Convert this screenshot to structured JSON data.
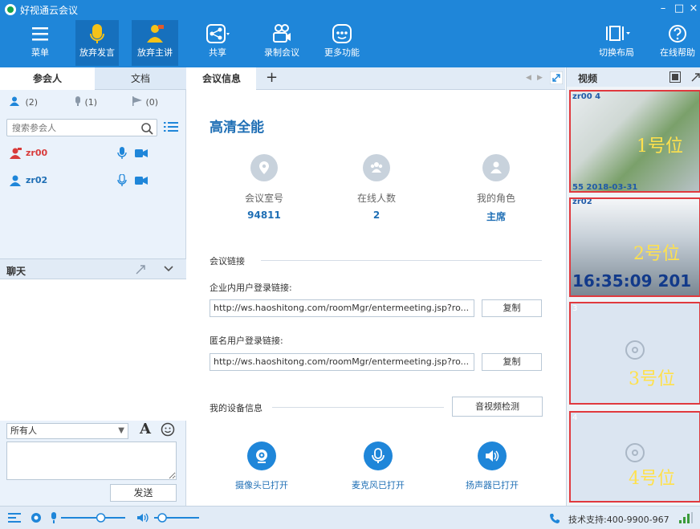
{
  "window": {
    "title": "好视通云会议"
  },
  "toolbar": {
    "menu": "菜单",
    "give_up_speaking": "放弃发言",
    "give_up_host": "放弃主讲",
    "share": "共享",
    "record": "录制会议",
    "more": "更多功能",
    "switch_layout": "切换布局",
    "help": "在线帮助"
  },
  "left": {
    "tabs": {
      "participants": "参会人",
      "documents": "文档"
    },
    "counts": {
      "people": "(2)",
      "mic": "(1)",
      "flag": "(0)"
    },
    "search": {
      "placeholder": "搜索参会人"
    },
    "participants": [
      {
        "name": "zr00",
        "role": "host"
      },
      {
        "name": "zr02",
        "role": "member"
      }
    ],
    "chat": {
      "title": "聊天",
      "recipient": "所有人",
      "font_button": "A",
      "send": "发送"
    }
  },
  "center": {
    "tabs": {
      "meeting_info": "会议信息",
      "add": "+"
    },
    "meeting_name": "高清全能",
    "stats": [
      {
        "label": "会议室号",
        "value": "94811"
      },
      {
        "label": "在线人数",
        "value": "2"
      },
      {
        "label": "我的角色",
        "value": "主席"
      }
    ],
    "links": {
      "section_title": "会议链接",
      "internal_label": "企业内用户登录链接:",
      "internal_url": "http://ws.haoshitong.com/roomMgr/entermeeting.jsp?ro...",
      "anonymous_label": "匿名用户登录链接:",
      "anonymous_url": "http://ws.haoshitong.com/roomMgr/entermeeting.jsp?ro...",
      "copy": "复制"
    },
    "devices": {
      "section_title": "我的设备信息",
      "check_button": "音视频检测",
      "camera": "摄像头已打开",
      "mic": "麦克风已打开",
      "speaker": "扬声器已打开"
    }
  },
  "video": {
    "title": "视频",
    "slots": [
      {
        "user": "zr00 4",
        "position": "1号位",
        "timestamp": "55 2018-03-31"
      },
      {
        "user": "zr02",
        "position": "2号位",
        "clock": "16:35:09 201"
      },
      {
        "number": "3",
        "position": "3号位"
      },
      {
        "number": "4",
        "position": "4号位"
      }
    ]
  },
  "status": {
    "support": "技术支持:400-9900-967",
    "mic_level": 0.62,
    "speaker_level": 0.18
  },
  "colors": {
    "brand": "#1f86d9",
    "accent_text": "#1f6fb5",
    "host_red": "#d83b3b",
    "slot_border": "#e0393e",
    "slot_label": "#ffe14d"
  }
}
